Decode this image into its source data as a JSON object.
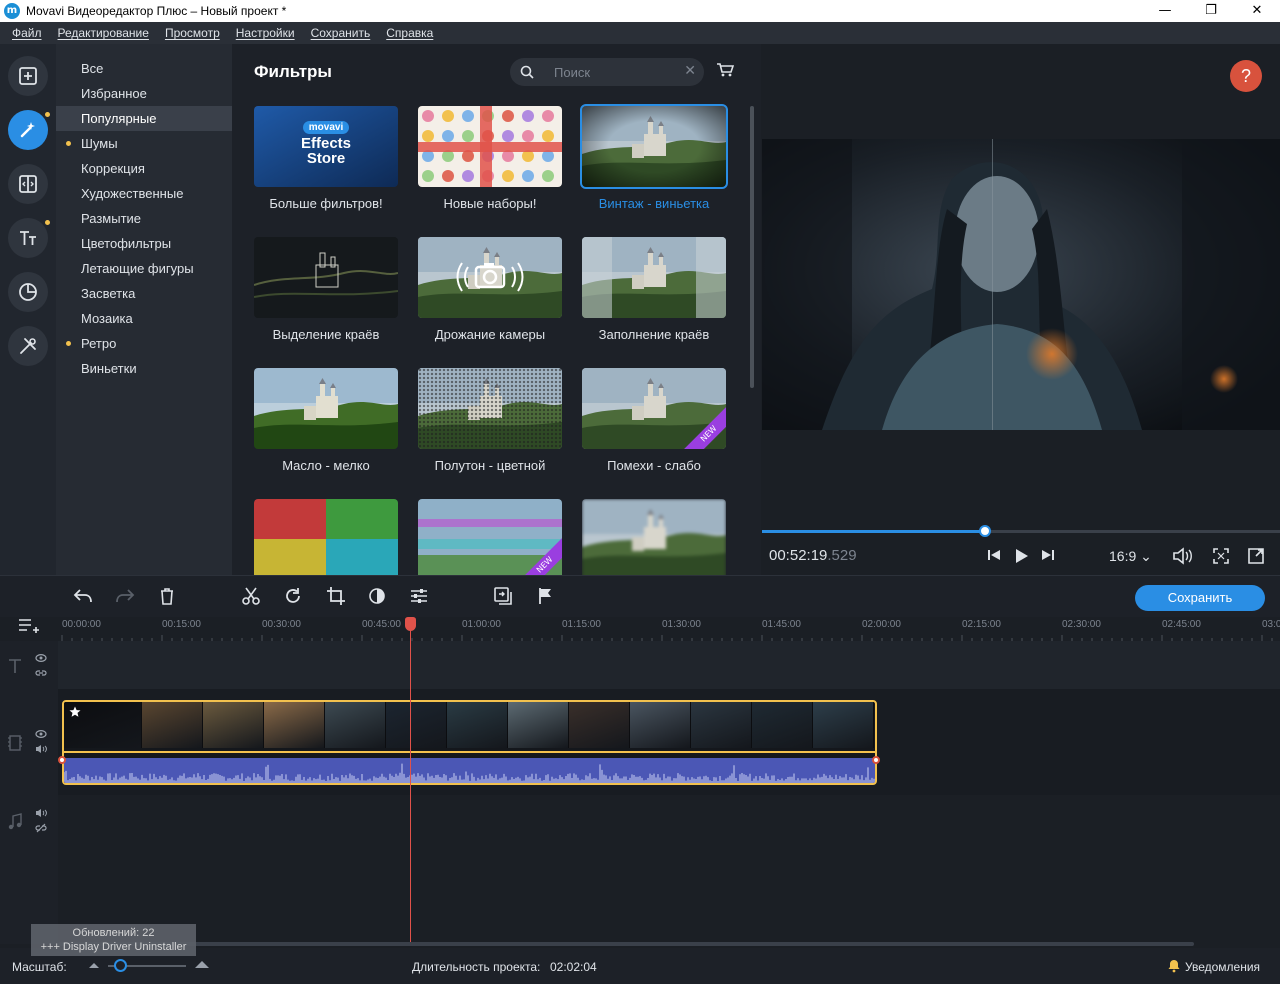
{
  "window": {
    "title": "Movavi Видеоредактор Плюс – Новый проект *",
    "minimize": "—",
    "restore": "❐",
    "close": "✕"
  },
  "menu": [
    "Файл",
    "Редактирование",
    "Просмотр",
    "Настройки",
    "Сохранить",
    "Справка"
  ],
  "rail": [
    {
      "icon": "import-icon",
      "active": false,
      "dot": false
    },
    {
      "icon": "magic-wand-icon",
      "active": true,
      "dot": true
    },
    {
      "icon": "transitions-icon",
      "active": false,
      "dot": false
    },
    {
      "icon": "titles-icon",
      "active": false,
      "dot": true
    },
    {
      "icon": "stickers-icon",
      "active": false,
      "dot": false
    },
    {
      "icon": "tools-icon",
      "active": false,
      "dot": false
    }
  ],
  "categories": [
    {
      "label": "Все",
      "selected": false,
      "dot": false
    },
    {
      "label": "Избранное",
      "selected": false,
      "dot": false
    },
    {
      "label": "Популярные",
      "selected": true,
      "dot": false
    },
    {
      "label": "Шумы",
      "selected": false,
      "dot": true
    },
    {
      "label": "Коррекция",
      "selected": false,
      "dot": false
    },
    {
      "label": "Художественные",
      "selected": false,
      "dot": false
    },
    {
      "label": "Размытие",
      "selected": false,
      "dot": false
    },
    {
      "label": "Цветофильтры",
      "selected": false,
      "dot": false
    },
    {
      "label": "Летающие фигуры",
      "selected": false,
      "dot": false
    },
    {
      "label": "Засветка",
      "selected": false,
      "dot": false
    },
    {
      "label": "Мозаика",
      "selected": false,
      "dot": false
    },
    {
      "label": "Ретро",
      "selected": false,
      "dot": true
    },
    {
      "label": "Виньетки",
      "selected": false,
      "dot": false
    }
  ],
  "filters_panel": {
    "title": "Фильтры",
    "search_placeholder": "Поиск",
    "clear": "✕",
    "store_logo": "movavi",
    "store_line1": "Effects",
    "store_line2": "Store",
    "new_badge": "NEW",
    "tiles": [
      {
        "label": "Больше фильтров!",
        "kind": "store"
      },
      {
        "label": "Новые наборы!",
        "kind": "stickers"
      },
      {
        "label": "Винтаж - виньетка",
        "kind": "vignette",
        "selected": true
      },
      {
        "label": "Выделение краёв",
        "kind": "edges"
      },
      {
        "label": "Дрожание камеры",
        "kind": "camera"
      },
      {
        "label": "Заполнение краёв",
        "kind": "fill"
      },
      {
        "label": "Масло - мелко",
        "kind": "castle"
      },
      {
        "label": "Полутон - цветной",
        "kind": "halftone"
      },
      {
        "label": "Помехи - слабо",
        "kind": "castle",
        "new": true
      },
      {
        "label": "",
        "kind": "quad"
      },
      {
        "label": "",
        "kind": "glitch",
        "new": true
      },
      {
        "label": "",
        "kind": "blur"
      }
    ]
  },
  "preview": {
    "help": "?",
    "timecode": "00:52:19",
    "frames": ".529",
    "aspect": "16:9",
    "progress": 0.43
  },
  "toolbar": {
    "save_label": "Сохранить"
  },
  "ruler": [
    "00:00:00",
    "00:15:00",
    "00:30:00",
    "00:45:00",
    "01:00:00",
    "01:15:00",
    "01:30:00",
    "01:45:00",
    "02:00:00",
    "02:15:00",
    "02:30:00",
    "02:45:00",
    "03:0"
  ],
  "status": {
    "zoom_label": "Масштаб:",
    "duration_label": "Длительность проекта:",
    "duration_value": "02:02:04",
    "notifications": "Уведомления"
  },
  "toast": {
    "line1": "Обновлений: 22",
    "line2": "+++ Display Driver Uninstaller"
  },
  "colors": {
    "accent": "#2a8ee4",
    "clip_border": "#f2c14e",
    "playhead": "#e0524a",
    "audio": "#4b57b5"
  }
}
